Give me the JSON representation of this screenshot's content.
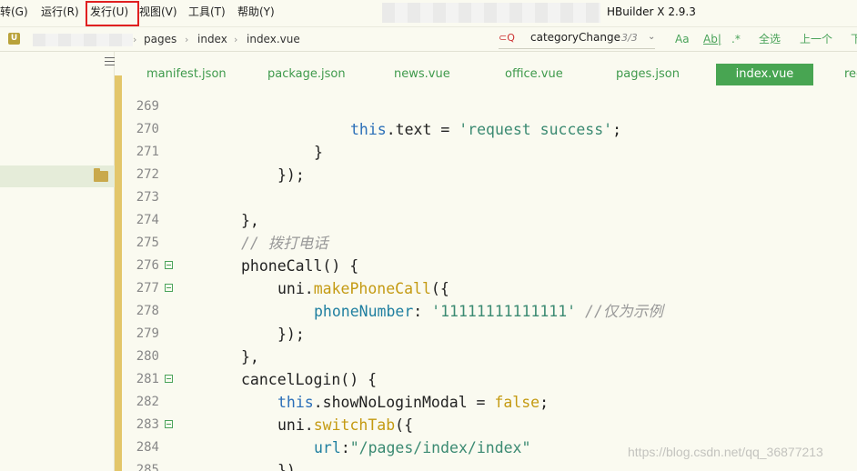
{
  "menubar": {
    "items": [
      {
        "label": "转(G)"
      },
      {
        "label": "运行(R)"
      },
      {
        "label": "发行(U)"
      },
      {
        "label": "视图(V)"
      },
      {
        "label": "工具(T)"
      },
      {
        "label": "帮助(Y)"
      }
    ],
    "app_title": "HBuilder X 2.9.3"
  },
  "navbar": {
    "project_icon": "U",
    "breadcrumb": [
      "pages",
      "index",
      "index.vue"
    ],
    "find": {
      "query": "categoryChange",
      "count": "3/3"
    },
    "buttons": {
      "case": "Aa",
      "word": "Ab|",
      "regex": ".*",
      "select_all": "全选",
      "prev": "上一个",
      "next": "下"
    }
  },
  "tabs": [
    {
      "label": "manifest.json"
    },
    {
      "label": "package.json"
    },
    {
      "label": "news.vue"
    },
    {
      "label": "office.vue"
    },
    {
      "label": "pages.json"
    },
    {
      "label": "index.vue",
      "active": true
    },
    {
      "label": "rec"
    }
  ],
  "editor": {
    "lines": [
      {
        "num": "269",
        "fold": false
      },
      {
        "num": "270",
        "fold": false
      },
      {
        "num": "271",
        "fold": false
      },
      {
        "num": "272",
        "fold": false
      },
      {
        "num": "273",
        "fold": false
      },
      {
        "num": "274",
        "fold": false
      },
      {
        "num": "275",
        "fold": false
      },
      {
        "num": "276",
        "fold": true
      },
      {
        "num": "277",
        "fold": true
      },
      {
        "num": "278",
        "fold": false
      },
      {
        "num": "279",
        "fold": false
      },
      {
        "num": "280",
        "fold": false
      },
      {
        "num": "281",
        "fold": true
      },
      {
        "num": "282",
        "fold": false
      },
      {
        "num": "283",
        "fold": true
      },
      {
        "num": "284",
        "fold": false
      },
      {
        "num": "285",
        "fold": false
      }
    ],
    "code": {
      "l270_this": "this",
      "l270_rest": ".text = ",
      "l270_str": "'request success'",
      "l270_end": ";",
      "l271": "}",
      "l272": "});",
      "l274": "},",
      "l275": "// 拨打电话",
      "l276": "phoneCall() {",
      "l277_obj": "uni.",
      "l277_fn": "makePhoneCall",
      "l277_end": "({",
      "l278_prop": "phoneNumber",
      "l278_colon": ": ",
      "l278_str": "'11111111111111'",
      "l278_cm": " //仅为示例",
      "l279": "});",
      "l280": "},",
      "l281": "cancelLogin() {",
      "l282_this": "this",
      "l282_rest": ".showNoLoginModal = ",
      "l282_val": "false",
      "l282_end": ";",
      "l283_obj": "uni.",
      "l283_fn": "switchTab",
      "l283_end": "({",
      "l284_prop": "url",
      "l284_colon": ":",
      "l284_str": "\"/pages/index/index\"",
      "l285": "})"
    }
  },
  "watermark": "https://blog.csdn.net/qq_36877213",
  "colors": {
    "accent": "#48a552",
    "highlight_box": "#e02020",
    "keyword": "#2b6fb8",
    "function": "#c49a12",
    "string": "#3b8a72"
  }
}
